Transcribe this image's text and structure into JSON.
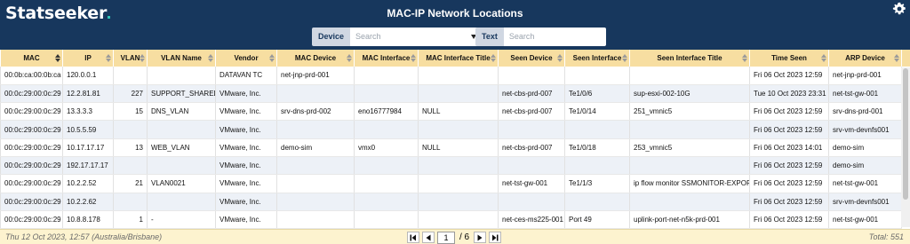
{
  "app": {
    "logo": "Statseeker",
    "title": "MAC-IP Network Locations"
  },
  "filters": {
    "device": {
      "label": "Device",
      "placeholder": "Search"
    },
    "text": {
      "label": "Text",
      "placeholder": "Search"
    }
  },
  "table": {
    "columns": [
      {
        "label": "MAC",
        "sort": "active"
      },
      {
        "label": "IP",
        "sort": ""
      },
      {
        "label": "VLAN",
        "sort": ""
      },
      {
        "label": "VLAN Name",
        "sort": ""
      },
      {
        "label": "Vendor",
        "sort": ""
      },
      {
        "label": "MAC Device",
        "sort": ""
      },
      {
        "label": "MAC Interface",
        "sort": ""
      },
      {
        "label": "MAC Interface Title",
        "sort": ""
      },
      {
        "label": "Seen Device",
        "sort": ""
      },
      {
        "label": "Seen Interface",
        "sort": ""
      },
      {
        "label": "Seen Interface Title",
        "sort": ""
      },
      {
        "label": "Time Seen",
        "sort": ""
      },
      {
        "label": "ARP Device",
        "sort": ""
      }
    ],
    "rows": [
      [
        "00:0b:ca:00:0b:ca",
        "120.0.0.1",
        "",
        "",
        "DATAVAN TC",
        "net-jnp-prd-001",
        "",
        "",
        "",
        "",
        "",
        "Fri 06 Oct 2023 12:59",
        "net-jnp-prd-001"
      ],
      [
        "00:0c:29:00:0c:29",
        "12.2.81.81",
        "227",
        "SUPPORT_SHARED",
        "VMware, Inc.",
        "",
        "",
        "",
        "net-cbs-prd-007",
        "Te1/0/6",
        "sup-esxi-002-10G",
        "Tue 10 Oct 2023 23:31",
        "net-tst-gw-001"
      ],
      [
        "00:0c:29:00:0c:29",
        "13.3.3.3",
        "15",
        "DNS_VLAN",
        "VMware, Inc.",
        "srv-dns-prd-002",
        "eno16777984",
        "NULL",
        "net-cbs-prd-007",
        "Te1/0/14",
        "251_vmnic5",
        "Fri 06 Oct 2023 12:59",
        "srv-dns-prd-001"
      ],
      [
        "00:0c:29:00:0c:29",
        "10.5.5.59",
        "",
        "",
        "VMware, Inc.",
        "",
        "",
        "",
        "",
        "",
        "",
        "Fri 06 Oct 2023 12:59",
        "srv-vm-devnfs001"
      ],
      [
        "00:0c:29:00:0c:29",
        "10.17.17.17",
        "13",
        "WEB_VLAN",
        "VMware, Inc.",
        "demo-sim",
        "vmx0",
        "NULL",
        "net-cbs-prd-007",
        "Te1/0/18",
        "253_vmnic5",
        "Fri 06 Oct 2023 14:01",
        "demo-sim"
      ],
      [
        "00:0c:29:00:0c:29",
        "192.17.17.17",
        "",
        "",
        "VMware, Inc.",
        "",
        "",
        "",
        "",
        "",
        "",
        "Fri 06 Oct 2023 12:59",
        "demo-sim"
      ],
      [
        "00:0c:29:00:0c:29",
        "10.2.2.52",
        "21",
        "VLAN0021",
        "VMware, Inc.",
        "",
        "",
        "",
        "net-tst-gw-001",
        "Te1/1/3",
        "ip flow monitor SSMONITOR-EXPORT",
        "Fri 06 Oct 2023 12:59",
        "net-tst-gw-001"
      ],
      [
        "00:0c:29:00:0c:29",
        "10.2.2.62",
        "",
        "",
        "VMware, Inc.",
        "",
        "",
        "",
        "",
        "",
        "",
        "Fri 06 Oct 2023 12:59",
        "srv-vm-devnfs001"
      ],
      [
        "00:0c:29:00:0c:29",
        "10.8.8.178",
        "1",
        "-",
        "VMware, Inc.",
        "",
        "",
        "",
        "net-ces-ms225-001",
        "Port 49",
        "uplink-port-net-n5k-prd-001",
        "Fri 06 Oct 2023 12:59",
        "net-tst-gw-001"
      ]
    ]
  },
  "footer": {
    "timestamp": "Thu 12 Oct 2023, 12:57 (Australia/Brisbane)",
    "page_current": "1",
    "page_total": "/ 6",
    "total": "Total: 551"
  }
}
